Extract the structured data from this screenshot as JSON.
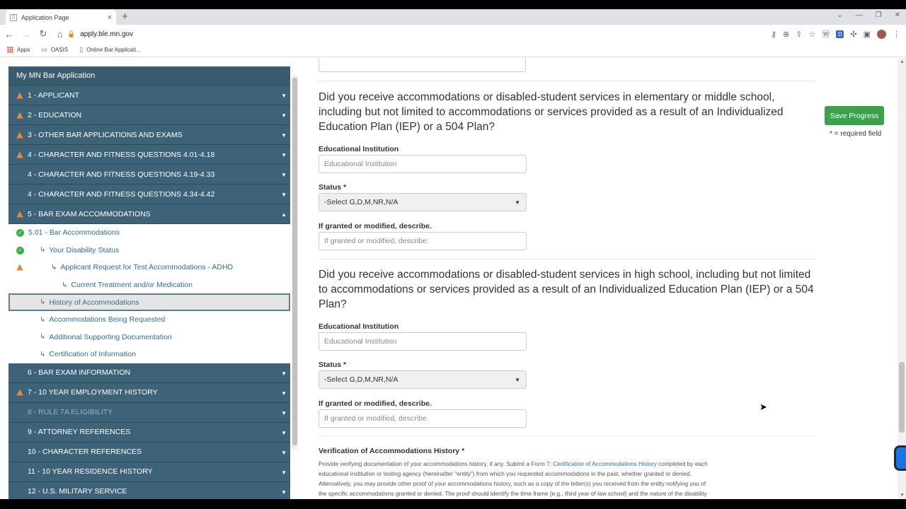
{
  "browser": {
    "tab_title": "Application Page",
    "tab_close": "×",
    "new_tab": "+",
    "url": "apply.ble.mn.gov",
    "bookmarks": [
      "Apps",
      "OASIS",
      "Online Bar Applicati..."
    ]
  },
  "sidebar": {
    "title": "My MN Bar Application",
    "sections_top": [
      {
        "label": "1 - APPLICANT",
        "warn": true
      },
      {
        "label": "2 - EDUCATION",
        "warn": true
      },
      {
        "label": "3 - OTHER BAR APPLICATIONS AND EXAMS",
        "warn": true
      },
      {
        "label": "4 - CHARACTER AND FITNESS QUESTIONS 4.01-4.18",
        "warn": true
      },
      {
        "label": "4 - CHARACTER AND FITNESS QUESTIONS 4.19-4.33",
        "warn": false
      },
      {
        "label": "4 - CHARACTER AND FITNESS QUESTIONS 4.34-4.42",
        "warn": false
      },
      {
        "label": "5 - BAR EXAM ACCOMMODATIONS",
        "warn": true
      }
    ],
    "subitems": [
      {
        "label": "5.01 - Bar Accommodations",
        "status": "check"
      },
      {
        "label": "Your Disability Status",
        "status": "check"
      },
      {
        "label": "Applicant Request for Test Accommodations - ADHD",
        "status": "warn"
      },
      {
        "label": "Current Treatment and/or Medication",
        "status": ""
      },
      {
        "label": "History of Accommodations",
        "status": ""
      },
      {
        "label": "Accommodations Being Requested",
        "status": ""
      },
      {
        "label": "Additional Supporting Documentation",
        "status": ""
      },
      {
        "label": "Certification of Information",
        "status": ""
      }
    ],
    "sections_bottom": [
      {
        "label": "6 - BAR EXAM INFORMATION",
        "warn": false
      },
      {
        "label": "7 - 10 YEAR EMPLOYMENT HISTORY",
        "warn": true
      },
      {
        "label": "8 - RULE 7A ELIGIBILITY",
        "warn": false
      },
      {
        "label": "9 - ATTORNEY REFERENCES",
        "warn": false
      },
      {
        "label": "10 - CHARACTER REFERENCES",
        "warn": false
      },
      {
        "label": "11 - 10 YEAR RESIDENCE HISTORY",
        "warn": false
      },
      {
        "label": "12 - U.S. MILITARY SERVICE",
        "warn": false
      }
    ]
  },
  "form": {
    "q1": "Did you receive accommodations or disabled-student services in elementary or middle school, including but not limited to accommodations or services provided as a result of an Individualized Education Plan (IEP) or a 504 Plan?",
    "q2": "Did you receive accommodations or disabled-student services in high school, including but not limited to accommodations or services provided as a result of an Individualized Education Plan (IEP) or a 504 Plan?",
    "institution_label": "Educational Institution",
    "institution_placeholder": "Educational Institution",
    "status_label": "Status *",
    "status_value": "-Select G,D,M,NR,N/A",
    "describe_label": "If granted or modified, describe.",
    "describe_placeholder": "If granted or modified, describe.",
    "verification_title": "Verification of Accommodations History *",
    "verification_text_a": "Provide verifying documentation of your accommodations history, if any. Submit a ",
    "verification_link": "Form 7: Certification of Accommodations History",
    "verification_text_b": " completed by each educational institution or testing agency (hereinafter “entity”) from which you requested accommodations in the past, whether granted or denied. Alternatively, you may provide other proof of your accommodations history, such as a copy of the letter(s) you received from the entity notifying you of the specific accommodations granted or denied. The proof should identify the time frame (e.g., third year of law school) and the nature of the disability (e.g., ADHD) for which any accommodations were granted or denied. If you received accommodations as a result of an IEP"
  },
  "actions": {
    "save_label": "Save Progress",
    "required_note": "* = required field"
  },
  "colors": {
    "sidebar_bg": "#3e6277",
    "save_green": "#3aa24a",
    "warn_orange": "#e8873a",
    "check_green": "#3bb34a"
  }
}
